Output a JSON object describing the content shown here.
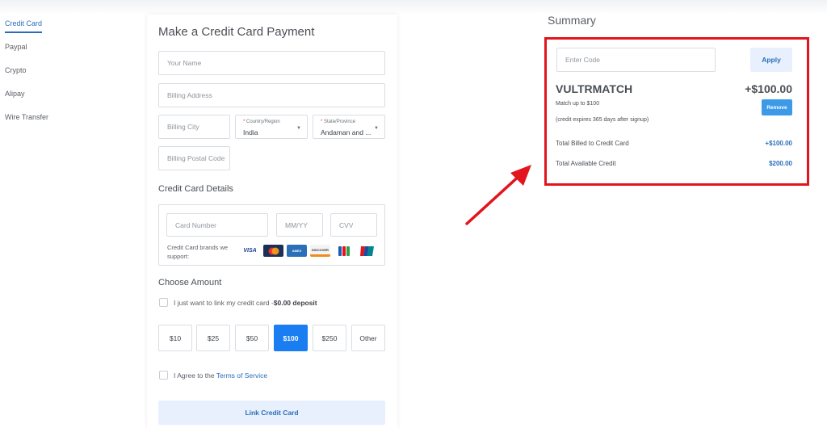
{
  "nav": {
    "items": [
      {
        "label": "Credit Card",
        "active": true
      },
      {
        "label": "Paypal"
      },
      {
        "label": "Crypto"
      },
      {
        "label": "Alipay"
      },
      {
        "label": "Wire Transfer"
      }
    ]
  },
  "form": {
    "title": "Make a Credit Card Payment",
    "name_placeholder": "Your Name",
    "address_placeholder": "Billing Address",
    "city_placeholder": "Billing City",
    "country_label": "Country/Region",
    "country_value": "India",
    "state_label": "State/Province",
    "state_value": "Andaman and ...",
    "postal_placeholder": "Billing Postal Code"
  },
  "card": {
    "section_title": "Credit Card Details",
    "number_placeholder": "Card Number",
    "expiry_placeholder": "MM/YY",
    "cvv_placeholder": "CVV",
    "brands_label": "Credit Card brands we support:",
    "brands": [
      "VISA",
      "MC",
      "AMEX",
      "DISCOVER",
      "JCB",
      "UNIONPAY"
    ]
  },
  "amount": {
    "section_title": "Choose Amount",
    "link_only_text": "I just want to link my credit card -",
    "link_only_bold": "$0.00 deposit",
    "options": [
      "$10",
      "$25",
      "$50",
      "$100",
      "$250",
      "Other"
    ],
    "selected": "$100",
    "agree_text": "I Agree to the ",
    "agree_link": "Terms of Service",
    "submit_label": "Link Credit Card"
  },
  "summary": {
    "title": "Summary",
    "code_placeholder": "Enter Code",
    "apply_label": "Apply",
    "promo_code": "VULTRMATCH",
    "promo_amount": "+$100.00",
    "match_text": "Match up to $100",
    "expiry_text": "(credit expires 365 days after signup)",
    "remove_label": "Remove",
    "billed_label": "Total Billed to Credit Card",
    "billed_value": "+$100.00",
    "credit_label": "Total Available Credit",
    "credit_value": "$200.00"
  },
  "colors": {
    "accent": "#1a7ef2",
    "link": "#2a6ebb",
    "highlight": "#e3141d"
  }
}
